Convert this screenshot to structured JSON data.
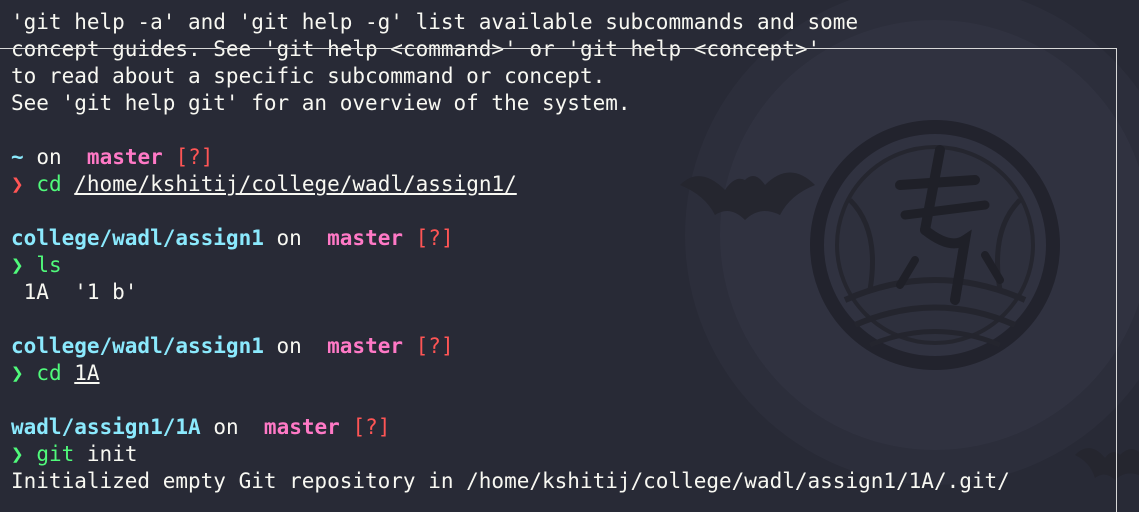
{
  "help_text": [
    "'git help -a' and 'git help -g' list available subcommands and some",
    "concept guides. See 'git help <command>' or 'git help <concept>'",
    "to read about a specific subcommand or concept.",
    "See 'git help git' for an overview of the system."
  ],
  "prompt_home": {
    "path": "~",
    "on": "on",
    "branch_icon": "",
    "branch": "master",
    "status": "[?]"
  },
  "prompt_symbol": "❯",
  "cmd_cd1": {
    "command": "cd",
    "argument": "/home/kshitij/college/wadl/assign1/"
  },
  "prompt_assign1_a": {
    "path": "college/wadl/assign1",
    "on": "on",
    "branch_icon": "",
    "branch": "master",
    "status": "[?]"
  },
  "cmd_ls": {
    "command": "ls"
  },
  "ls_output": " 1A  '1 b'",
  "prompt_assign1_b": {
    "path": "college/wadl/assign1",
    "on": "on",
    "branch_icon": "",
    "branch": "master",
    "status": "[?]"
  },
  "cmd_cd2": {
    "command": "cd",
    "argument": "1A"
  },
  "prompt_1a": {
    "path": "wadl/assign1/1A",
    "on": "on",
    "branch_icon": "",
    "branch": "master",
    "status": "[?]"
  },
  "cmd_git": {
    "command": "git",
    "argument": "init"
  },
  "git_output": "Initialized empty Git repository in /home/kshitij/college/wadl/assign1/1A/.git/",
  "colors": {
    "background": "#282a36",
    "foreground": "#f8f8f2",
    "path": "#8be9fd",
    "branch": "#ff79c6",
    "status": "#ff5555",
    "prompt_ok": "#50fa7b",
    "prompt_error": "#ff5555"
  }
}
